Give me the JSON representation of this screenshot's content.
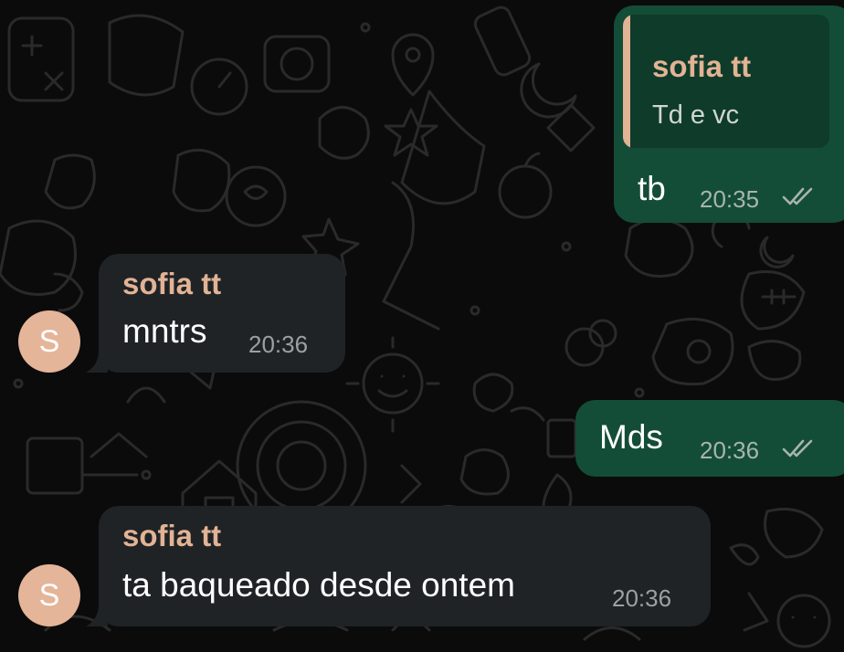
{
  "colors": {
    "background": "#0b0b0b",
    "outgoing_bubble": "#134d37",
    "incoming_bubble": "#1f2326",
    "sender_name": "#e2b394",
    "avatar": "#e4b599",
    "read_ticks": "#a9b4ae"
  },
  "messages": [
    {
      "direction": "outgoing",
      "reply_to": {
        "sender": "sofia tt",
        "text": "Td e vc"
      },
      "text": "tb",
      "time": "20:35",
      "status_icon": "double-check-icon"
    },
    {
      "direction": "incoming",
      "sender": "sofia tt",
      "avatar_letter": "S",
      "text": "mntrs",
      "time": "20:36"
    },
    {
      "direction": "outgoing",
      "text": "Mds",
      "time": "20:36",
      "status_icon": "double-check-icon"
    },
    {
      "direction": "incoming",
      "sender": "sofia tt",
      "avatar_letter": "S",
      "text": "ta baqueado desde ontem",
      "time": "20:36"
    }
  ]
}
